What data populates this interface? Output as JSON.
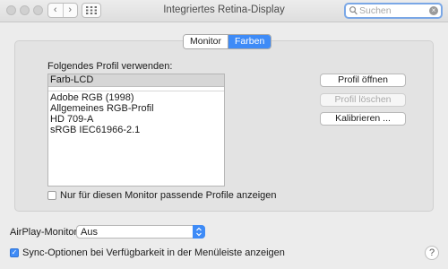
{
  "window": {
    "title": "Integriertes Retina-Display",
    "back_glyph": "‹",
    "forward_glyph": "›",
    "grid_icon": "grid-icon"
  },
  "search": {
    "placeholder": "Suchen",
    "icon": "search-icon"
  },
  "tabs": [
    {
      "label": "Monitor",
      "active": false
    },
    {
      "label": "Farben",
      "active": true
    }
  ],
  "profiles": {
    "label": "Folgendes Profil verwenden:",
    "current": "Farb-LCD",
    "items": [
      "Adobe RGB (1998)",
      "Allgemeines RGB-Profil",
      "HD 709-A",
      "sRGB IEC61966-2.1"
    ]
  },
  "buttons": {
    "open": "Profil öffnen",
    "delete": "Profil löschen",
    "calibrate": "Kalibrieren ..."
  },
  "filter_checkbox": {
    "label": "Nur für diesen Monitor passende Profile anzeigen",
    "checked": false
  },
  "airplay": {
    "label": "AirPlay-Monitor:",
    "value": "Aus"
  },
  "sync_checkbox": {
    "label": "Sync-Optionen bei Verfügbarkeit in der Menüleiste anzeigen",
    "checked": true
  },
  "help": {
    "label": "?"
  },
  "colors": {
    "accent": "#3e8bf7",
    "focus_ring": "#7aa7e6",
    "window_bg": "#ececec"
  }
}
